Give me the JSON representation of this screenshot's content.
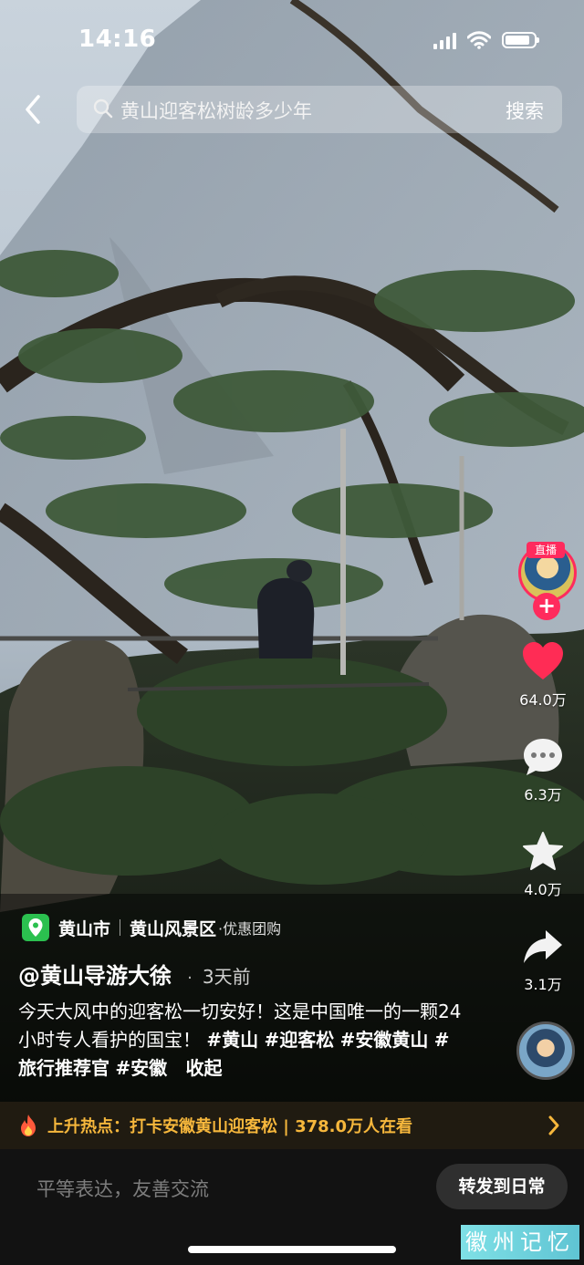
{
  "status_bar": {
    "time": "14:16",
    "battery_level": 0.85
  },
  "search": {
    "query": "黄山迎客松树龄多少年",
    "button": "搜索"
  },
  "rail": {
    "live_tag": "直播",
    "follow": "+",
    "likes": "64.0万",
    "comments": "6.3万",
    "favorites": "4.0万",
    "shares": "3.1万"
  },
  "location": {
    "city": "黄山市",
    "area": "黄山风景区",
    "deal": "·优惠团购"
  },
  "author": {
    "name": "@黄山导游大徐",
    "sep": "·",
    "ago": "3天前"
  },
  "caption": {
    "text": "今天大风中的迎客松一切安好！这是中国唯一的一颗24小时专人看护的国宝！",
    "tags": [
      "#黄山",
      "#迎客松",
      "#安徽黄山",
      "#旅行推荐官",
      "#安徽"
    ],
    "more": "收起"
  },
  "hot": {
    "text": "上升热点：打卡安徽黄山迎客松 | 378.0万人在看"
  },
  "comment_bar": {
    "placeholder": "平等表达，友善交流",
    "share": "转发到日常"
  },
  "watermark": "徽州记忆",
  "colors": {
    "accent_red": "#ff2b5d",
    "hot_orange": "#f6b73c",
    "location_green": "#2bc04f"
  },
  "icons": [
    "back-icon",
    "search-icon",
    "heart-icon",
    "comment-icon",
    "star-icon",
    "share-icon",
    "fire-icon",
    "chevron-right-icon",
    "location-pin-icon"
  ]
}
